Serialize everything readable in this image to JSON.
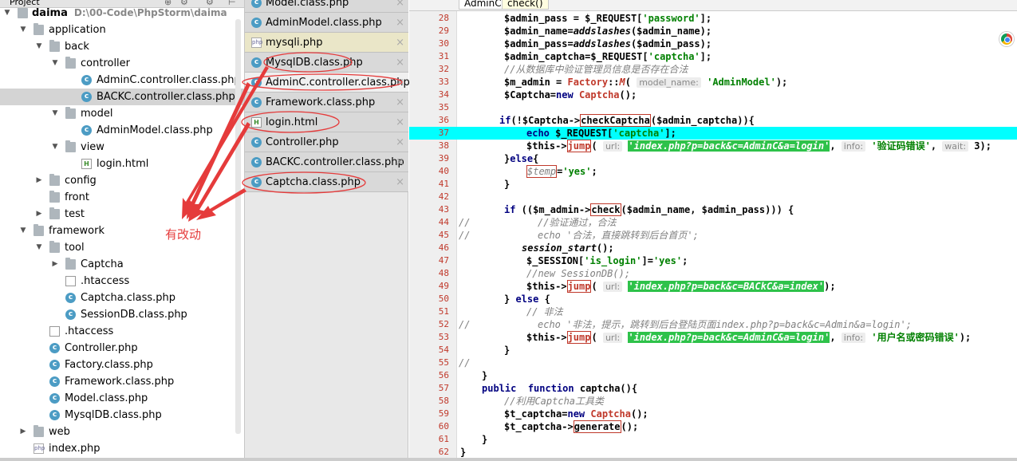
{
  "project_panel": {
    "title": "Project",
    "root_name": "daima",
    "root_path": "D:\\00-Code\\PhpStorm\\daima"
  },
  "tree": [
    {
      "label": "application",
      "type": "folder",
      "indent": 1,
      "arrow": "down"
    },
    {
      "label": "back",
      "type": "folder",
      "indent": 2,
      "arrow": "down"
    },
    {
      "label": "controller",
      "type": "folder",
      "indent": 3,
      "arrow": "down"
    },
    {
      "label": "AdminC.controller.class.php",
      "type": "class",
      "indent": 4
    },
    {
      "label": "BACKC.controller.class.php",
      "type": "class",
      "indent": 4,
      "selected": true
    },
    {
      "label": "model",
      "type": "folder",
      "indent": 3,
      "arrow": "down"
    },
    {
      "label": "AdminModel.class.php",
      "type": "class",
      "indent": 4
    },
    {
      "label": "view",
      "type": "folder",
      "indent": 3,
      "arrow": "down"
    },
    {
      "label": "login.html",
      "type": "html",
      "indent": 4
    },
    {
      "label": "config",
      "type": "folder",
      "indent": 2,
      "arrow": "right"
    },
    {
      "label": "front",
      "type": "folder",
      "indent": 2,
      "arrow": ""
    },
    {
      "label": "test",
      "type": "folder",
      "indent": 2,
      "arrow": "right"
    },
    {
      "label": "framework",
      "type": "folder",
      "indent": 1,
      "arrow": "down"
    },
    {
      "label": "tool",
      "type": "folder",
      "indent": 2,
      "arrow": "down"
    },
    {
      "label": "Captcha",
      "type": "folder",
      "indent": 3,
      "arrow": "right"
    },
    {
      "label": ".htaccess",
      "type": "hta",
      "indent": 3
    },
    {
      "label": "Captcha.class.php",
      "type": "class",
      "indent": 3
    },
    {
      "label": "SessionDB.class.php",
      "type": "class",
      "indent": 3
    },
    {
      "label": ".htaccess",
      "type": "hta",
      "indent": 2
    },
    {
      "label": "Controller.php",
      "type": "class",
      "indent": 2
    },
    {
      "label": "Factory.class.php",
      "type": "class",
      "indent": 2
    },
    {
      "label": "Framework.class.php",
      "type": "class",
      "indent": 2
    },
    {
      "label": "Model.class.php",
      "type": "class",
      "indent": 2
    },
    {
      "label": "MysqlDB.class.php",
      "type": "class",
      "indent": 2
    },
    {
      "label": "web",
      "type": "folder",
      "indent": 1,
      "arrow": "right"
    },
    {
      "label": "index.php",
      "type": "php",
      "indent": 1
    }
  ],
  "open_tabs": [
    {
      "label": "Model.class.php",
      "type": "class"
    },
    {
      "label": "AdminModel.class.php",
      "type": "class"
    },
    {
      "label": "mysqli.php",
      "type": "php",
      "yellow": true
    },
    {
      "label": "MysqlDB.class.php",
      "type": "class"
    },
    {
      "label": "AdminC.controller.class.php",
      "type": "class",
      "active": true
    },
    {
      "label": "Framework.class.php",
      "type": "class"
    },
    {
      "label": "login.html",
      "type": "html"
    },
    {
      "label": "Controller.php",
      "type": "class"
    },
    {
      "label": "BACKC.controller.class.php",
      "type": "class"
    },
    {
      "label": "Captcha.class.php",
      "type": "class"
    }
  ],
  "tab_close_glyph": "×",
  "breadcrumbs": [
    "AdminC",
    "check()"
  ],
  "annotation_note": "有改动",
  "code": {
    "l28": [
      "28",
      "$admin_pass = $_REQUEST[",
      "'password'",
      "];"
    ],
    "l29": [
      "29",
      "$admin_name=",
      "addslashes",
      "($admin_name);"
    ],
    "l30": [
      "30",
      "$admin_pass=",
      "addslashes",
      "($admin_pass);"
    ],
    "l31": [
      "31",
      "$admin_captcha=$_REQUEST[",
      "'captcha'",
      "];"
    ],
    "l32": [
      "32",
      "//从数据库中验证管理员信息是否存在合法"
    ],
    "l33": [
      "33",
      "$m_admin = ",
      "Factory",
      "::",
      "M",
      "(",
      "model_name:",
      "'AdminModel'",
      ");"
    ],
    "l34": [
      "34",
      "$Captcha=",
      "new",
      " Captcha",
      "();"
    ],
    "l35": [
      "35"
    ],
    "l36": [
      "36",
      "if",
      "(!$Captcha->",
      "checkCaptcha",
      "($admin_captcha)){"
    ],
    "l37": [
      "37",
      "echo",
      " $_REQUEST[",
      "'captcha'",
      "];"
    ],
    "l38": [
      "38",
      "$this->",
      "jump",
      "(",
      "url:",
      "'index.php?p=back&c=AdminC&a=login'",
      ", ",
      "info:",
      "'验证码错误'",
      ", ",
      "wait:",
      " 3);"
    ],
    "l39": [
      "39",
      "}",
      "else",
      "{"
    ],
    "l40": [
      "40",
      "$temp",
      "=",
      "'yes'",
      ";"
    ],
    "l41": [
      "41",
      "}"
    ],
    "l42": [
      "42"
    ],
    "l43": [
      "43",
      "if",
      " (($m_admin->",
      "check",
      "($admin_name, $admin_pass))) {"
    ],
    "l44": [
      "44",
      "//",
      "//验证通过，合法"
    ],
    "l45": [
      "45",
      "//",
      "echo '合法，直接跳转到后台首页';"
    ],
    "l46": [
      "46",
      "session_start",
      "();"
    ],
    "l47": [
      "47",
      "$_SESSION[",
      "'is_login'",
      "]=",
      "'yes'",
      ";"
    ],
    "l48": [
      "48",
      "//new SessionDB();"
    ],
    "l49": [
      "49",
      "$this->",
      "jump",
      "(",
      "url:",
      "'index.php?p=back&c=BACkC&a=index'",
      ");"
    ],
    "l50": [
      "50",
      "} ",
      "else",
      " {"
    ],
    "l51": [
      "51",
      "// 非法"
    ],
    "l52": [
      "52",
      "//",
      "echo '非法，提示，跳转到后台登陆页面index.php?p=back&c=Admin&a=login';"
    ],
    "l53": [
      "53",
      "$this->",
      "jump",
      "(",
      "url:",
      "'index.php?p=back&c=AdminC&a=login'",
      ", ",
      "info:",
      "'用户名或密码错误'",
      ");"
    ],
    "l54": [
      "54",
      "}"
    ],
    "l55": [
      "55",
      "//"
    ],
    "l56": [
      "56",
      "}"
    ],
    "l57": [
      "57",
      "public",
      "  ",
      "function",
      " ",
      "captcha",
      "(){"
    ],
    "l58": [
      "58",
      "//利用Captcha工具类"
    ],
    "l59": [
      "59",
      "$t_captcha=",
      "new",
      " ",
      "Captcha",
      "();"
    ],
    "l60": [
      "60",
      "$t_captcha->",
      "generate",
      "();"
    ],
    "l61": [
      "61",
      "}"
    ],
    "l62": [
      "62",
      "}"
    ]
  },
  "colors": {
    "current_line": "#00ffff",
    "annotation": "#e53b3b",
    "string_hint_bg": "#2ec24a"
  }
}
